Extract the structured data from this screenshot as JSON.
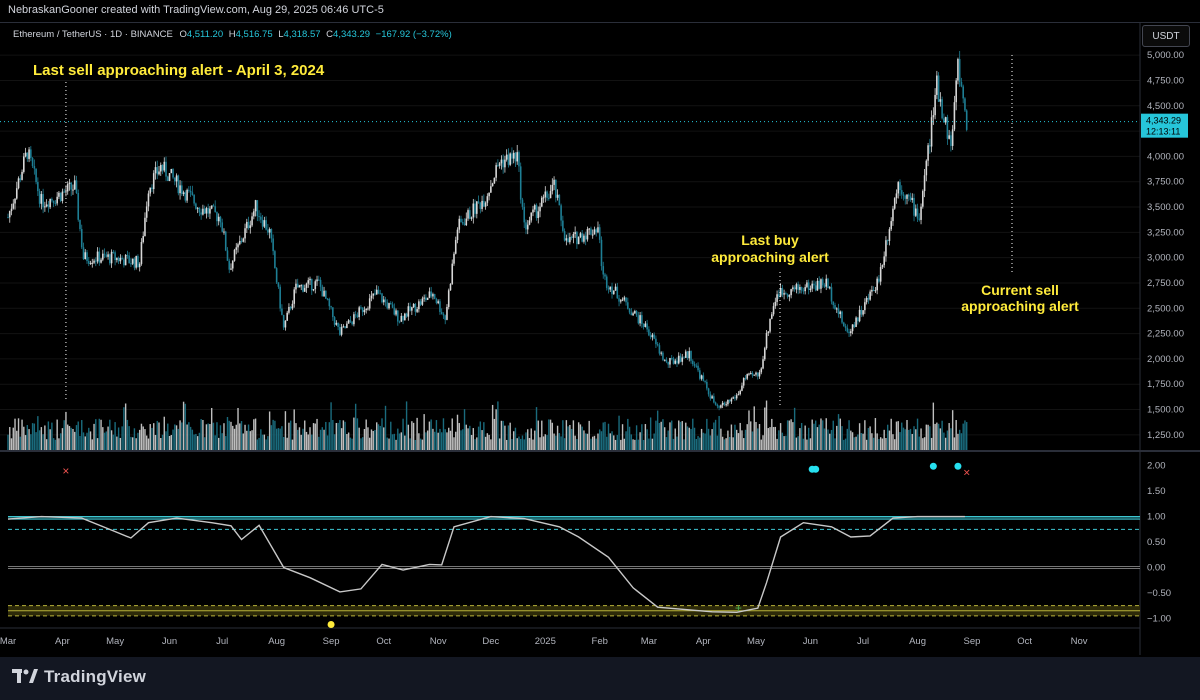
{
  "header": {
    "credit": "NebraskanGooner created with TradingView.com, Aug 29, 2025 06:46 UTC-5"
  },
  "legend": {
    "symbol": "Ethereum / TetherUS · 1D · BINANCE",
    "open_label": "O",
    "open": "4,511.20",
    "high_label": "H",
    "high": "4,516.75",
    "low_label": "L",
    "low": "4,318.57",
    "close_label": "C",
    "close": "4,343.29",
    "change": "−167.92 (−3.72%)"
  },
  "currency_button": "USDT",
  "price_tag": {
    "price": "4,343.29",
    "countdown": "12:13:11"
  },
  "annotations": {
    "sell_april": "Last sell approaching alert - April 3, 2024",
    "buy_line1": "Last buy",
    "buy_line2": "approaching alert",
    "current_line1": "Current sell",
    "current_line2": "approaching alert"
  },
  "footer": {
    "brand": "TradingView"
  },
  "colors": {
    "accent": "#ffeb3b",
    "up": "#26a69a",
    "down": "#ef5350",
    "price": "#2962ff",
    "osc_line": "#c8c8c8",
    "band": "#3ec7d2"
  },
  "chart_data": [
    {
      "type": "candlestick",
      "title": "Ethereum / TetherUS · 1D · BINANCE",
      "x_range": [
        "2024-03-01",
        "2025-11-30"
      ],
      "ylim": [
        1100,
        5150
      ],
      "y_ticks": [
        "5,000.00",
        "4,750.00",
        "4,500.00",
        "4,250.00",
        "4,000.00",
        "3,750.00",
        "3,500.00",
        "3,250.00",
        "3,000.00",
        "2,750.00",
        "2,500.00",
        "2,250.00",
        "2,000.00",
        "1,750.00",
        "1,500.00",
        "1,250.00"
      ],
      "y_tick_values": [
        5000,
        4750,
        4500,
        4250,
        4000,
        3750,
        3500,
        3250,
        3000,
        2750,
        2500,
        2250,
        2000,
        1750,
        1500,
        1250
      ],
      "price_path": [
        [
          "2024-03-01",
          3400
        ],
        [
          "2024-03-12",
          4050
        ],
        [
          "2024-03-20",
          3550
        ],
        [
          "2024-03-28",
          3600
        ],
        [
          "2024-04-08",
          3700
        ],
        [
          "2024-04-13",
          3000
        ],
        [
          "2024-04-30",
          3000
        ],
        [
          "2024-05-15",
          2950
        ],
        [
          "2024-05-20",
          3700
        ],
        [
          "2024-05-27",
          3900
        ],
        [
          "2024-06-07",
          3700
        ],
        [
          "2024-06-18",
          3500
        ],
        [
          "2024-06-30",
          3400
        ],
        [
          "2024-07-05",
          2900
        ],
        [
          "2024-07-20",
          3500
        ],
        [
          "2024-07-28",
          3250
        ],
        [
          "2024-08-05",
          2300
        ],
        [
          "2024-08-12",
          2700
        ],
        [
          "2024-08-25",
          2750
        ],
        [
          "2024-09-06",
          2250
        ],
        [
          "2024-09-27",
          2650
        ],
        [
          "2024-10-10",
          2400
        ],
        [
          "2024-10-29",
          2650
        ],
        [
          "2024-11-05",
          2400
        ],
        [
          "2024-11-12",
          3300
        ],
        [
          "2024-11-28",
          3600
        ],
        [
          "2024-12-06",
          3950
        ],
        [
          "2024-12-16",
          4000
        ],
        [
          "2024-12-20",
          3300
        ],
        [
          "2025-01-06",
          3700
        ],
        [
          "2025-01-13",
          3150
        ],
        [
          "2025-01-31",
          3300
        ],
        [
          "2025-02-03",
          2800
        ],
        [
          "2025-02-28",
          2300
        ],
        [
          "2025-03-11",
          1950
        ],
        [
          "2025-03-24",
          2050
        ],
        [
          "2025-04-09",
          1500
        ],
        [
          "2025-04-21",
          1650
        ],
        [
          "2025-04-24",
          1800
        ],
        [
          "2025-05-03",
          1850
        ],
        [
          "2025-05-09",
          2400
        ],
        [
          "2025-05-13",
          2650
        ],
        [
          "2025-06-10",
          2750
        ],
        [
          "2025-06-22",
          2250
        ],
        [
          "2025-07-01",
          2500
        ],
        [
          "2025-07-10",
          2800
        ],
        [
          "2025-07-21",
          3750
        ],
        [
          "2025-08-02",
          3400
        ],
        [
          "2025-08-12",
          4700
        ],
        [
          "2025-08-20",
          4100
        ],
        [
          "2025-08-24",
          4900
        ],
        [
          "2025-08-29",
          4343
        ]
      ],
      "last_price": 4343.29,
      "volume_note": "volume histogram at chart bottom"
    },
    {
      "type": "line",
      "series": [
        {
          "name": "",
          "path": [
            [
              "2024-03-01",
              0.95
            ],
            [
              "2024-03-20",
              1.0
            ],
            [
              "2024-04-12",
              0.97
            ],
            [
              "2024-04-30",
              0.72
            ],
            [
              "2024-05-10",
              0.58
            ],
            [
              "2024-05-20",
              0.88
            ],
            [
              "2024-06-05",
              0.97
            ],
            [
              "2024-06-25",
              0.88
            ],
            [
              "2024-07-06",
              0.82
            ],
            [
              "2024-07-12",
              0.55
            ],
            [
              "2024-07-22",
              0.83
            ],
            [
              "2024-08-05",
              0.0
            ],
            [
              "2024-08-20",
              -0.2
            ],
            [
              "2024-09-06",
              -0.48
            ],
            [
              "2024-09-18",
              -0.42
            ],
            [
              "2024-09-30",
              0.06
            ],
            [
              "2024-10-12",
              -0.05
            ],
            [
              "2024-10-27",
              0.06
            ],
            [
              "2024-11-03",
              0.05
            ],
            [
              "2024-11-10",
              0.8
            ],
            [
              "2024-12-01",
              1.0
            ],
            [
              "2024-12-20",
              0.96
            ],
            [
              "2025-01-09",
              0.8
            ],
            [
              "2025-01-20",
              0.6
            ],
            [
              "2025-02-06",
              0.2
            ],
            [
              "2025-02-20",
              -0.4
            ],
            [
              "2025-03-06",
              -0.78
            ],
            [
              "2025-04-06",
              -0.87
            ],
            [
              "2025-04-20",
              -0.88
            ],
            [
              "2025-05-02",
              -0.8
            ],
            [
              "2025-05-07",
              -0.3
            ],
            [
              "2025-05-15",
              0.6
            ],
            [
              "2025-05-28",
              0.88
            ],
            [
              "2025-06-13",
              0.8
            ],
            [
              "2025-06-24",
              0.6
            ],
            [
              "2025-07-05",
              0.62
            ],
            [
              "2025-07-18",
              0.97
            ],
            [
              "2025-08-01",
              1.0
            ],
            [
              "2025-08-28",
              1.0
            ]
          ]
        }
      ],
      "ylim": [
        -1.15,
        2.25
      ],
      "y_ticks": [
        "2.00",
        "1.50",
        "1.00",
        "0.50",
        "0.00",
        "−0.50",
        "−1.00"
      ],
      "y_tick_values": [
        2.0,
        1.5,
        1.0,
        0.5,
        0.0,
        -0.5,
        -1.0
      ],
      "x_ticks": [
        "Mar",
        "Apr",
        "May",
        "Jun",
        "Jul",
        "Aug",
        "Sep",
        "Oct",
        "Nov",
        "Dec",
        "2025",
        "Feb",
        "Mar",
        "Apr",
        "May",
        "Jun",
        "Jul",
        "Aug",
        "Sep",
        "Oct",
        "Nov"
      ],
      "x_tick_dates": [
        "2024-03-01",
        "2024-04-01",
        "2024-05-01",
        "2024-06-01",
        "2024-07-01",
        "2024-08-01",
        "2024-09-01",
        "2024-10-01",
        "2024-11-01",
        "2024-12-01",
        "2025-01-01",
        "2025-02-01",
        "2025-03-01",
        "2025-04-01",
        "2025-05-01",
        "2025-06-01",
        "2025-07-01",
        "2025-08-01",
        "2025-09-01",
        "2025-10-01",
        "2025-11-01"
      ],
      "levels": [
        1.0,
        0.95,
        0.75,
        0.0,
        -0.75,
        -0.85,
        -0.95
      ],
      "sell_markers": [
        [
          "2024-04-03",
          1.9
        ],
        [
          "2025-08-29",
          1.87
        ]
      ],
      "buy_markers": [
        [
          "2025-04-21",
          -0.8
        ]
      ],
      "cyan_dots": [
        [
          "2025-06-02",
          1.93
        ],
        [
          "2025-06-04",
          1.93
        ],
        [
          "2025-08-10",
          1.99
        ],
        [
          "2025-08-24",
          1.99
        ]
      ],
      "yellow_dots": [
        [
          "2024-09-01",
          -1.12
        ]
      ]
    }
  ]
}
